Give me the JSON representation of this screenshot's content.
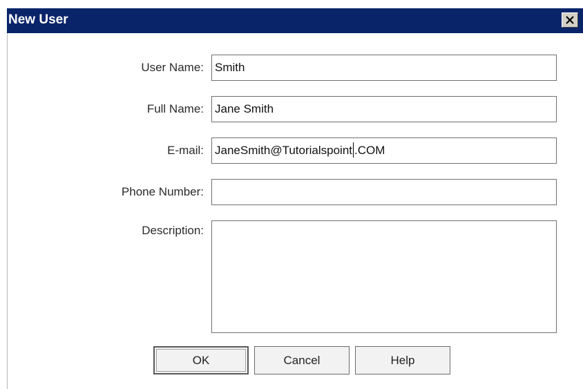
{
  "window": {
    "title": "New User",
    "close_icon": "close-icon"
  },
  "form": {
    "user_name": {
      "label": "User Name:",
      "value": "Smith"
    },
    "full_name": {
      "label": "Full Name:",
      "value": "Jane Smith"
    },
    "email": {
      "label": "E-mail:",
      "value_before_caret": "JaneSmith@Tutorialspoint",
      "value_after_caret": ".COM"
    },
    "phone": {
      "label": "Phone Number:",
      "value": ""
    },
    "description": {
      "label": "Description:",
      "value": ""
    }
  },
  "buttons": {
    "ok": "OK",
    "cancel": "Cancel",
    "help": "Help"
  },
  "colors": {
    "titlebar": "#0a246a",
    "dialog_background": "#ffffff"
  }
}
